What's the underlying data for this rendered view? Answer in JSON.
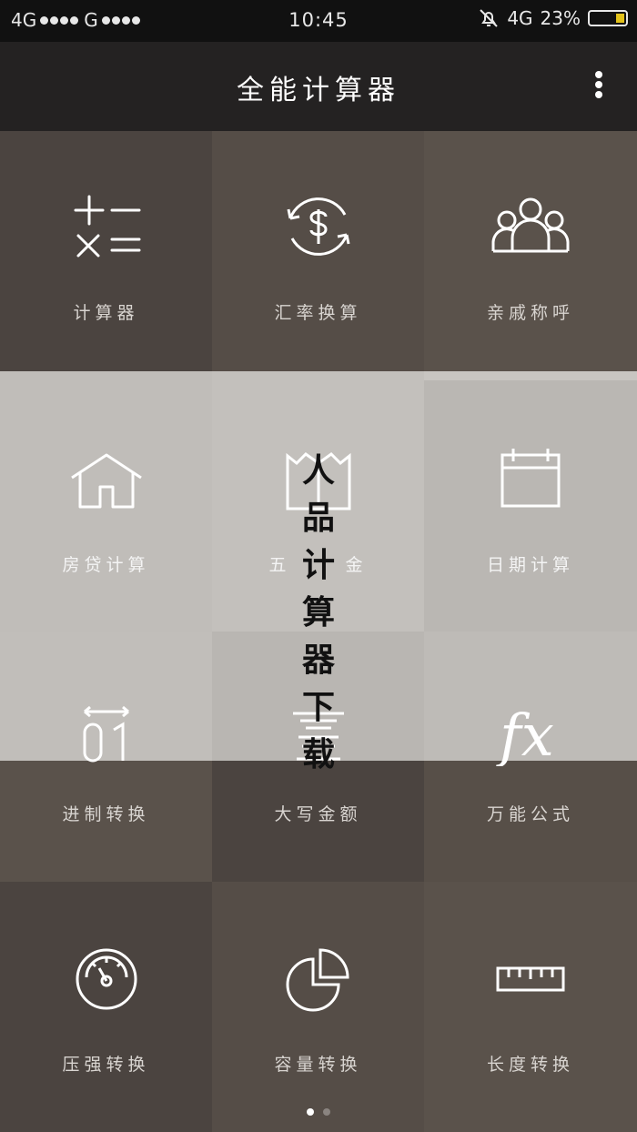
{
  "status_bar": {
    "sim1": "4G",
    "sim2": "G",
    "time": "10:45",
    "network": "4G",
    "battery_percent": "23%",
    "battery_level": 0.23,
    "battery_fill_color": "#e3c21a"
  },
  "app_bar": {
    "title": "全能计算器",
    "menu_icon": "more-vertical-icon"
  },
  "tiles": [
    {
      "label": "计算器",
      "icon": "calculator-icon"
    },
    {
      "label": "汇率换算",
      "icon": "currency-exchange-icon"
    },
    {
      "label": "亲戚称呼",
      "icon": "family-icon"
    },
    {
      "label": "房贷计算",
      "icon": "house-icon"
    },
    {
      "label": "五险一金",
      "icon": "insurance-icon"
    },
    {
      "label": "日期计算",
      "icon": "calendar-icon"
    },
    {
      "label": "进制转换",
      "icon": "binary-icon"
    },
    {
      "label": "大写金额",
      "icon": "chinese-numeral-icon"
    },
    {
      "label": "万能公式",
      "icon": "formula-fx-icon"
    },
    {
      "label": "压强转换",
      "icon": "pressure-gauge-icon"
    },
    {
      "label": "容量转换",
      "icon": "pie-chart-icon"
    },
    {
      "label": "长度转换",
      "icon": "ruler-icon"
    }
  ],
  "tile_label_visible": [
    "计算器",
    "汇率换算",
    "亲戚称呼",
    "房贷计算",
    "五",
    "金",
    "日期计算",
    "进制转换",
    "大写金额",
    "万能公式",
    "压强转换",
    "容量转换",
    "长度转换"
  ],
  "overlay_text": [
    "人",
    "品",
    "计",
    "算",
    "器",
    "下",
    "载"
  ],
  "pager": {
    "page_count": 2,
    "active_page": 1,
    "active_color": "#ffffff",
    "inactive_color": "#8a8480"
  }
}
